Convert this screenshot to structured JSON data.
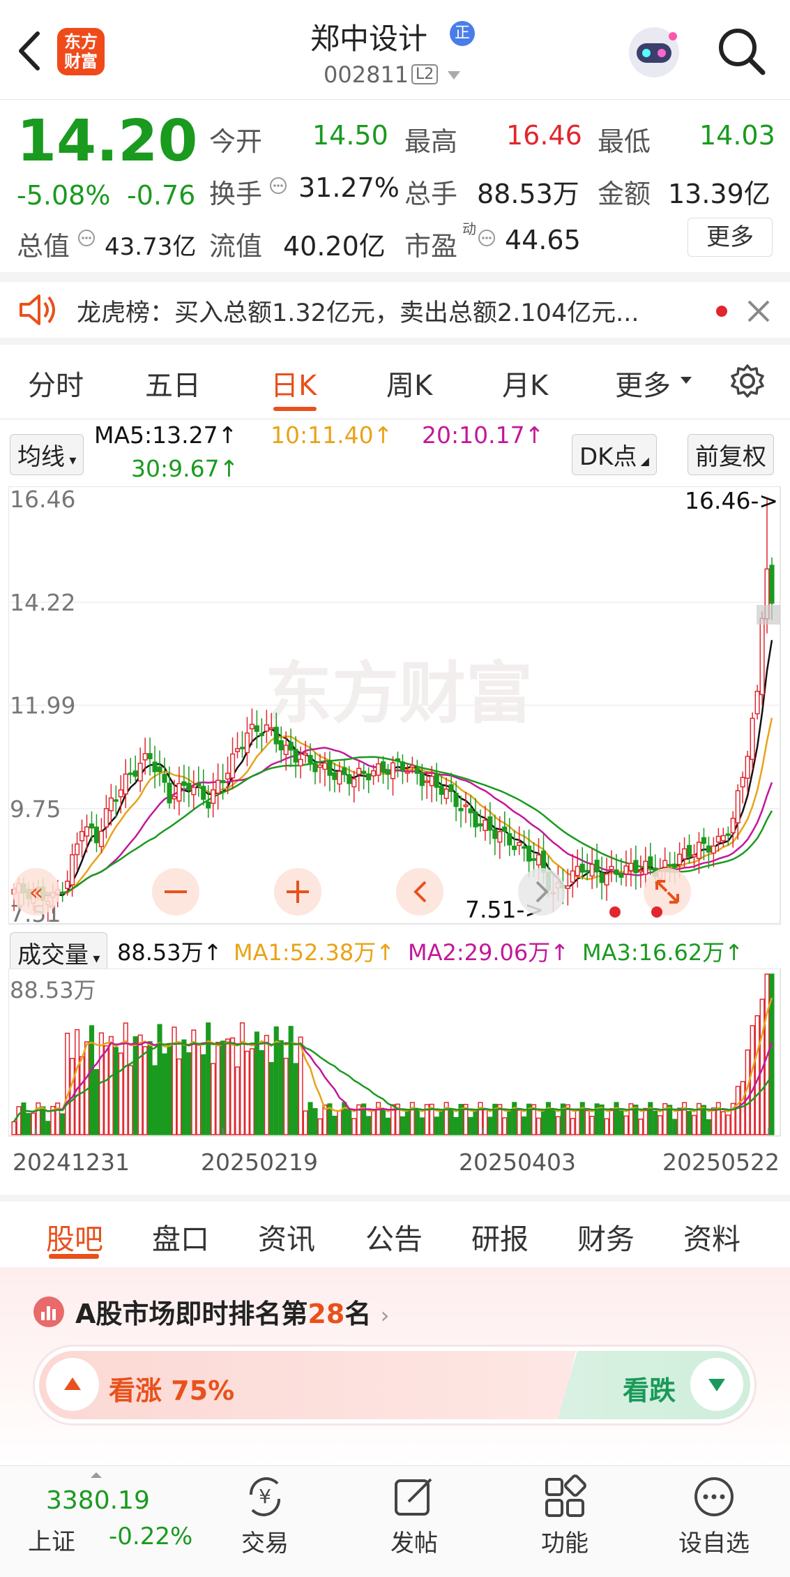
{
  "header": {
    "back_icon": "chevron-left-icon",
    "logo_text": "东方\n财富",
    "stock_name": "郑中设计",
    "verified_badge": "正",
    "stock_code": "002811",
    "level_badge": "L2",
    "assistant_icon": "robot-avatar-icon",
    "search_icon": "search-icon"
  },
  "quote": {
    "price": "14.20",
    "change_pct": "-5.08%",
    "change_amt": "-0.76",
    "open_label": "今开",
    "open": "14.50",
    "high_label": "最高",
    "high": "16.46",
    "low_label": "最低",
    "low": "14.03",
    "turnover_label": "换手",
    "turnover": "31.27%",
    "volume_label": "总手",
    "volume": "88.53万",
    "amount_label": "金额",
    "amount": "13.39亿",
    "mktcap_label": "总值",
    "mktcap": "43.73亿",
    "float_label": "流值",
    "float": "40.20亿",
    "pe_label": "市盈",
    "pe_sup": "动",
    "pe": "44.65",
    "more_button": "更多"
  },
  "notice": {
    "text": "龙虎榜：买入总额1.32亿元，卖出总额2.104亿元..."
  },
  "chart_tabs": [
    "分时",
    "五日",
    "日K",
    "周K",
    "月K",
    "更多"
  ],
  "chart_tab_active": 2,
  "ma_bar": {
    "selector": "均线",
    "ma5": "MA5:13.27↑",
    "ma10": "10:11.40↑",
    "ma20": "20:10.17↑",
    "ma30": "30:9.67↑",
    "dk_button": "DK点",
    "fq_button": "前复权"
  },
  "kline": {
    "y_labels": [
      "16.46",
      "14.22",
      "11.99",
      "9.75",
      "7.51"
    ],
    "max_marker": "16.46->",
    "min_marker": "7.51->",
    "watermark": "东方财富",
    "colors": {
      "up": "#e0262e",
      "down": "#1a9a1f",
      "ma5": "#111111",
      "ma10": "#e8a317",
      "ma20": "#c2189a",
      "ma30": "#1a9a1f"
    }
  },
  "volume_bar": {
    "selector": "成交量",
    "vol": "88.53万↑",
    "ma1": "MA1:52.38万↑",
    "ma2": "MA2:29.06万↑",
    "ma3": "MA3:16.62万↑",
    "y_label": "88.53万",
    "dates": [
      "20241231",
      "20250219",
      "20250403",
      "20250522"
    ]
  },
  "bottom_tabs": [
    "股吧",
    "盘口",
    "资讯",
    "公告",
    "研报",
    "财务",
    "资料"
  ],
  "bottom_tab_active": 0,
  "ranking": {
    "prefix": "A股市场即时排名第",
    "rank": "28",
    "suffix": "名"
  },
  "sentiment": {
    "bull_label": "看涨 75%",
    "bear_label": "看跌"
  },
  "navbar": {
    "index_value": "3380.19",
    "index_name": "上证",
    "index_change": "-0.22%",
    "items": [
      "交易",
      "发帖",
      "功能",
      "设自选"
    ]
  },
  "chart_data": {
    "type": "candlestick",
    "y_range": [
      7.51,
      16.46
    ],
    "x_labels": [
      "20241231",
      "20250219",
      "20250403",
      "20250522"
    ],
    "last_close": 14.2,
    "high": 16.46,
    "low": 7.51,
    "series": [
      {
        "name": "MA5",
        "last": 13.27
      },
      {
        "name": "MA10",
        "last": 11.4
      },
      {
        "name": "MA20",
        "last": 10.17
      },
      {
        "name": "MA30",
        "last": 9.67
      }
    ],
    "volume": {
      "last": "88.53万",
      "MA1": "52.38万",
      "MA2": "29.06万",
      "MA3": "16.62万"
    }
  }
}
